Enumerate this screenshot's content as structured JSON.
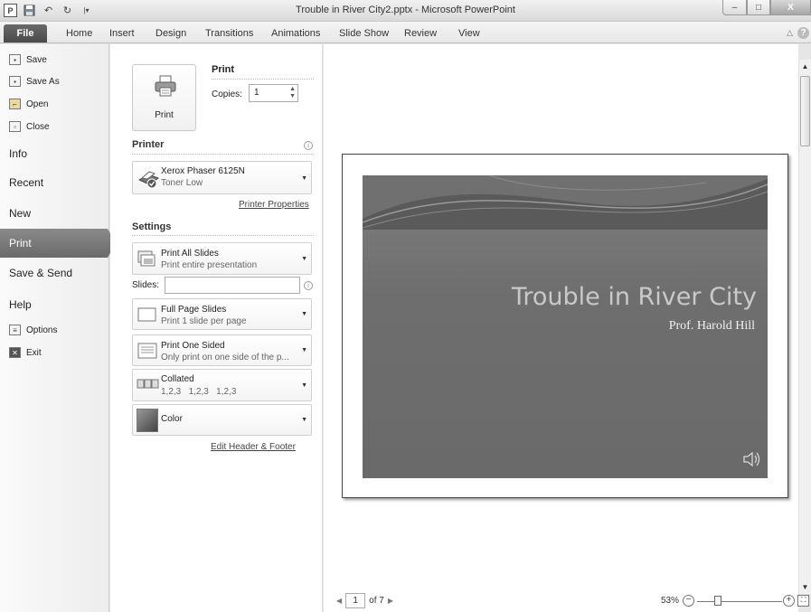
{
  "window": {
    "title": "Trouble in River City2.pptx - Microsoft PowerPoint",
    "app_icon": "P",
    "qat_icons": [
      "save-icon",
      "undo-icon",
      "redo-icon",
      "customize-qat-icon"
    ],
    "controls": {
      "minimize": "–",
      "maximize": "□",
      "close": "X"
    }
  },
  "ribbon": {
    "file_tab": "File",
    "tabs": [
      "Home",
      "Insert",
      "Design",
      "Transitions",
      "Animations",
      "Slide Show",
      "Review",
      "View"
    ]
  },
  "backstage_nav": {
    "small_items": [
      {
        "label": "Save",
        "icon": "save-icon"
      },
      {
        "label": "Save As",
        "icon": "save-as-icon"
      },
      {
        "label": "Open",
        "icon": "open-folder-icon"
      },
      {
        "label": "Close",
        "icon": "close-file-icon"
      }
    ],
    "big_items": [
      "Info",
      "Recent",
      "New",
      "Print",
      "Save & Send",
      "Help"
    ],
    "selected": "Print",
    "footer_items": [
      {
        "label": "Options",
        "icon": "options-icon"
      },
      {
        "label": "Exit",
        "icon": "exit-icon"
      }
    ]
  },
  "print_panel": {
    "print_button": "Print",
    "heading": "Print",
    "copies_label": "Copies:",
    "copies_value": "1",
    "printer_section": "Printer",
    "printer": {
      "name": "Xerox Phaser 6125N",
      "status": "Toner Low"
    },
    "printer_properties_link": "Printer Properties",
    "settings_section": "Settings",
    "settings": [
      {
        "title": "Print All Slides",
        "desc": "Print entire presentation"
      },
      {
        "title": "Full Page Slides",
        "desc": "Print 1 slide per page"
      },
      {
        "title": "Print One Sided",
        "desc": "Only print on one side of the p..."
      },
      {
        "title": "Collated",
        "desc": "1,2,3   1,2,3   1,2,3"
      },
      {
        "title": "Color",
        "desc": ""
      }
    ],
    "slides_label": "Slides:",
    "slides_value": "",
    "edit_header_footer_link": "Edit Header & Footer"
  },
  "preview": {
    "slide_title": "Trouble in River City",
    "slide_subtitle": "Prof. Harold Hill",
    "current_page": "1",
    "page_total": "of 7",
    "zoom_percent": "53%"
  }
}
